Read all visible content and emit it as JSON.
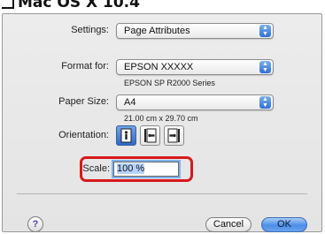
{
  "heading": {
    "text": "Mac OS X 10.4"
  },
  "dialog": {
    "settings": {
      "label": "Settings:",
      "value": "Page Attributes"
    },
    "format_for": {
      "label": "Format for:",
      "value": "EPSON XXXXX",
      "detail": "EPSON SP R2000 Series"
    },
    "paper_size": {
      "label": "Paper Size:",
      "value": "A4",
      "detail": "21.00 cm x 29.70 cm"
    },
    "orientation": {
      "label": "Orientation:",
      "options": [
        {
          "name": "portrait",
          "selected": true
        },
        {
          "name": "landscape-left",
          "selected": false
        },
        {
          "name": "landscape-right",
          "selected": false
        }
      ]
    },
    "scale": {
      "label": "Scale:",
      "value": "100 %"
    },
    "help_glyph": "?",
    "buttons": {
      "cancel": "Cancel",
      "ok": "OK"
    }
  },
  "colors": {
    "highlight": "#d7191c",
    "accent": "#2f6fd6"
  }
}
